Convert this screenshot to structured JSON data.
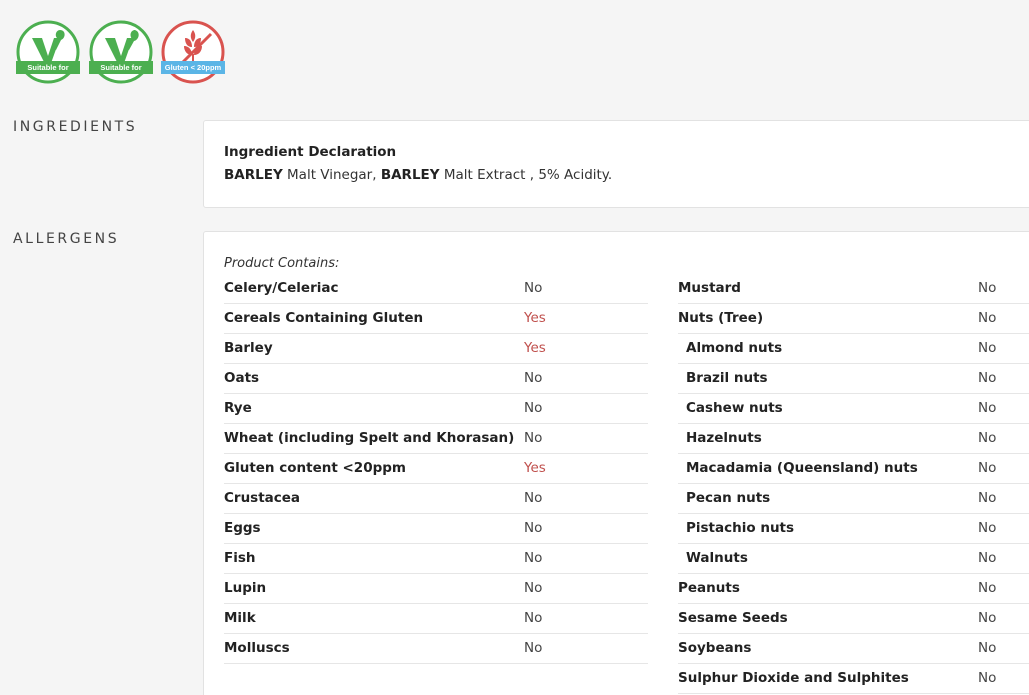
{
  "badges": [
    {
      "label": "Suitable for",
      "icon": "vegetarian-v-icon",
      "color": "#4caf50"
    },
    {
      "label": "Suitable for",
      "icon": "vegan-v-icon",
      "color": "#4caf50"
    },
    {
      "label": "Gluten < 20ppm",
      "icon": "wheat-icon",
      "color": "#d9534f"
    }
  ],
  "ingredients": {
    "section_title": "INGREDIENTS",
    "heading": "Ingredient Declaration",
    "part1_bold": "BARLEY",
    "part1_text": " Malt Vinegar, ",
    "part2_bold": "BARLEY",
    "part2_text": " Malt Extract , 5% Acidity."
  },
  "allergens": {
    "section_title": "ALLERGENS",
    "contains_label": "Product Contains:",
    "left": [
      {
        "name": "Celery/Celeriac",
        "value": "No"
      },
      {
        "name": "Cereals Containing Gluten",
        "value": "Yes"
      },
      {
        "name": "Barley",
        "value": "Yes"
      },
      {
        "name": "Oats",
        "value": "No"
      },
      {
        "name": "Rye",
        "value": "No"
      },
      {
        "name": "Wheat (including Spelt and Khorasan)",
        "value": "No"
      },
      {
        "name": "Gluten content <20ppm",
        "value": "Yes"
      },
      {
        "name": "Crustacea",
        "value": "No"
      },
      {
        "name": "Eggs",
        "value": "No"
      },
      {
        "name": "Fish",
        "value": "No"
      },
      {
        "name": "Lupin",
        "value": "No"
      },
      {
        "name": "Milk",
        "value": "No"
      },
      {
        "name": "Molluscs",
        "value": "No"
      }
    ],
    "right": [
      {
        "name": "Mustard",
        "value": "No",
        "sub": false
      },
      {
        "name": "Nuts (Tree)",
        "value": "No",
        "sub": false
      },
      {
        "name": "Almond nuts",
        "value": "No",
        "sub": true
      },
      {
        "name": "Brazil nuts",
        "value": "No",
        "sub": true
      },
      {
        "name": "Cashew nuts",
        "value": "No",
        "sub": true
      },
      {
        "name": "Hazelnuts",
        "value": "No",
        "sub": true
      },
      {
        "name": "Macadamia (Queensland) nuts",
        "value": "No",
        "sub": true
      },
      {
        "name": "Pecan nuts",
        "value": "No",
        "sub": true
      },
      {
        "name": "Pistachio nuts",
        "value": "No",
        "sub": true
      },
      {
        "name": "Walnuts",
        "value": "No",
        "sub": true
      },
      {
        "name": "Peanuts",
        "value": "No",
        "sub": false
      },
      {
        "name": "Sesame Seeds",
        "value": "No",
        "sub": false
      },
      {
        "name": "Soybeans",
        "value": "No",
        "sub": false
      },
      {
        "name": "Sulphur Dioxide and Sulphites",
        "value": "No",
        "sub": false
      }
    ]
  }
}
